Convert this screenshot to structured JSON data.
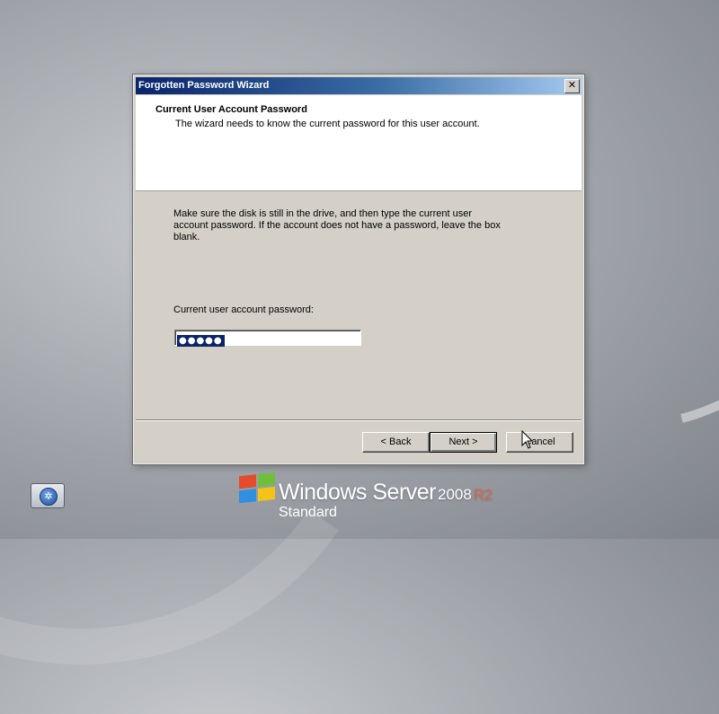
{
  "wizard": {
    "title": "Forgotten Password Wizard",
    "close_glyph": "✕",
    "header_title": "Current User Account Password",
    "header_subtitle": "The wizard needs to know the current password for this user account.",
    "instructions": "Make sure the disk is still in the drive, and then type the current user account password. If the account does not have a password, leave the box blank.",
    "password_label": "Current user account password:",
    "password_value_masked": "●●●●●",
    "buttons": {
      "back": "< Back",
      "next": "Next >",
      "cancel": "Cancel"
    }
  },
  "desktop": {
    "accessibility_glyph": "✲",
    "brand_name": "Windows Server",
    "brand_version": "2008",
    "brand_release": "R2",
    "brand_edition": "Standard"
  },
  "colors": {
    "titlebar_start": "#0a246a",
    "titlebar_end": "#a6caf0",
    "dialog_face": "#d4d0c8",
    "selection": "#0a246a",
    "r2_accent": "#d7684f"
  },
  "icons": [
    "close-icon",
    "accessibility-icon",
    "windows-flag-icon",
    "mouse-cursor-icon"
  ]
}
